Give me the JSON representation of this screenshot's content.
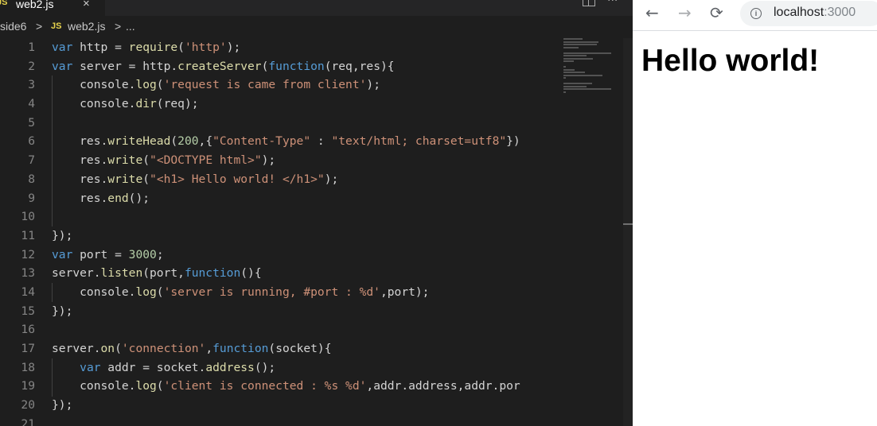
{
  "editor": {
    "tab": {
      "badge": "JS",
      "label": "web2.js",
      "close": "×"
    },
    "more": "···",
    "breadcrumb": {
      "folder": "side6",
      "separator": ">",
      "badge": "JS",
      "file": "web2.js",
      "tail": "..."
    },
    "line_numbers": [
      "1",
      "2",
      "3",
      "4",
      "5",
      "6",
      "7",
      "8",
      "9",
      "10",
      "11",
      "12",
      "13",
      "14",
      "15",
      "16",
      "17",
      "18",
      "19",
      "20",
      "21"
    ],
    "code_lines": [
      [
        [
          "kw",
          "var"
        ],
        [
          "nm",
          " http = "
        ],
        [
          "fnc",
          "require"
        ],
        [
          "nm",
          "("
        ],
        [
          "str",
          "'http'"
        ],
        [
          "nm",
          ");"
        ]
      ],
      [
        [
          "kw",
          "var"
        ],
        [
          "nm",
          " server = http."
        ],
        [
          "fnc",
          "createServer"
        ],
        [
          "nm",
          "("
        ],
        [
          "kw",
          "function"
        ],
        [
          "nm",
          "(req,res){"
        ]
      ],
      [
        [
          "nm",
          "    console."
        ],
        [
          "fnc",
          "log"
        ],
        [
          "nm",
          "("
        ],
        [
          "str",
          "'request is came from client'"
        ],
        [
          "nm",
          ");"
        ]
      ],
      [
        [
          "nm",
          "    console."
        ],
        [
          "fnc",
          "dir"
        ],
        [
          "nm",
          "(req);"
        ]
      ],
      [],
      [
        [
          "nm",
          "    res."
        ],
        [
          "fnc",
          "writeHead"
        ],
        [
          "nm",
          "("
        ],
        [
          "num",
          "200"
        ],
        [
          "nm",
          ",{"
        ],
        [
          "str",
          "\"Content-Type\""
        ],
        [
          "nm",
          " : "
        ],
        [
          "str",
          "\"text/html; charset=utf8\""
        ],
        [
          "nm",
          "})"
        ]
      ],
      [
        [
          "nm",
          "    res."
        ],
        [
          "fnc",
          "write"
        ],
        [
          "nm",
          "("
        ],
        [
          "str",
          "\"<DOCTYPE html>\""
        ],
        [
          "nm",
          ");"
        ]
      ],
      [
        [
          "nm",
          "    res."
        ],
        [
          "fnc",
          "write"
        ],
        [
          "nm",
          "("
        ],
        [
          "str",
          "\"<h1> Hello world! </h1>\""
        ],
        [
          "nm",
          ");"
        ]
      ],
      [
        [
          "nm",
          "    res."
        ],
        [
          "fnc",
          "end"
        ],
        [
          "nm",
          "();"
        ]
      ],
      [],
      [
        [
          "nm",
          "});"
        ]
      ],
      [
        [
          "kw",
          "var"
        ],
        [
          "nm",
          " port = "
        ],
        [
          "num",
          "3000"
        ],
        [
          "nm",
          ";"
        ]
      ],
      [
        [
          "nm",
          "server."
        ],
        [
          "fnc",
          "listen"
        ],
        [
          "nm",
          "(port,"
        ],
        [
          "kw",
          "function"
        ],
        [
          "nm",
          "(){"
        ]
      ],
      [
        [
          "nm",
          "    console."
        ],
        [
          "fnc",
          "log"
        ],
        [
          "nm",
          "("
        ],
        [
          "str",
          "'server is running, #port : %d'"
        ],
        [
          "nm",
          ",port);"
        ]
      ],
      [
        [
          "nm",
          "});"
        ]
      ],
      [],
      [
        [
          "nm",
          "server."
        ],
        [
          "fnc",
          "on"
        ],
        [
          "nm",
          "("
        ],
        [
          "str",
          "'connection'"
        ],
        [
          "nm",
          ","
        ],
        [
          "kw",
          "function"
        ],
        [
          "nm",
          "(socket){"
        ]
      ],
      [
        [
          "nm",
          "    "
        ],
        [
          "kw",
          "var"
        ],
        [
          "nm",
          " addr = socket."
        ],
        [
          "fnc",
          "address"
        ],
        [
          "nm",
          "();"
        ]
      ],
      [
        [
          "nm",
          "    console."
        ],
        [
          "fnc",
          "log"
        ],
        [
          "nm",
          "("
        ],
        [
          "str",
          "'client is connected : %s %d'"
        ],
        [
          "nm",
          ",addr.address,addr.por"
        ]
      ],
      [
        [
          "nm",
          "});"
        ]
      ],
      []
    ]
  },
  "browser": {
    "back_icon": "←",
    "forward_icon": "→",
    "reload_icon": "⟳",
    "info_icon": "i",
    "url_host": "localhost",
    "url_port": ":3000",
    "heading": "Hello world!"
  },
  "colors": {
    "keyword": "#569cd6",
    "function": "#dcdcaa",
    "string": "#ce9178",
    "number": "#b5cea8",
    "text": "#d4d4d4"
  }
}
